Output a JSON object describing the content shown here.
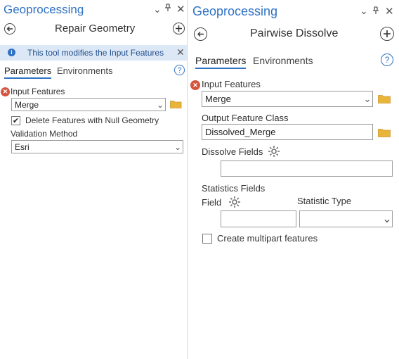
{
  "left": {
    "title": "Geoprocessing",
    "controls": {
      "chevron": "⌄",
      "pin": "⊥",
      "close": "✕"
    },
    "tool_name": "Repair Geometry",
    "info_message": "This tool modifies the Input Features",
    "tabs": [
      "Parameters",
      "Environments"
    ],
    "input_features_label": "Input Features",
    "input_features_value": "Merge",
    "delete_null_label": "Delete Features with Null Geometry",
    "delete_null_checked": true,
    "validation_method_label": "Validation Method",
    "validation_method_value": "Esri"
  },
  "right": {
    "title": "Geoprocessing",
    "controls": {
      "chevron": "⌄",
      "pin": "⊥",
      "close": "✕"
    },
    "tool_name": "Pairwise Dissolve",
    "tabs": [
      "Parameters",
      "Environments"
    ],
    "input_features_label": "Input Features",
    "input_features_value": "Merge",
    "output_class_label": "Output Feature Class",
    "output_class_value": "Dissolved_Merge",
    "dissolve_fields_label": "Dissolve Fields",
    "dissolve_fields_value": "",
    "statistics_fields_label": "Statistics Fields",
    "field_label": "Field",
    "statistic_type_label": "Statistic Type",
    "field_value": "",
    "statistic_type_value": "",
    "multipart_label": "Create multipart features",
    "multipart_checked": false
  },
  "colors": {
    "accent": "#2f72c4",
    "error": "#d5523d",
    "folder": "#e8b53a",
    "info_bg": "#dde8f6"
  }
}
